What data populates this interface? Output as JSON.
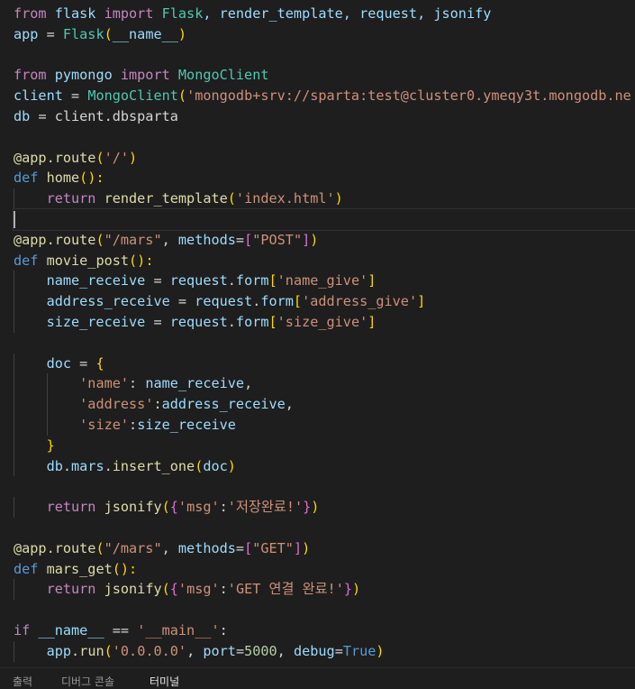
{
  "editor": {
    "language": "python",
    "current_line_index": 10,
    "lines": [
      {
        "tokens": [
          {
            "t": "from",
            "c": "k"
          },
          {
            "t": " flask ",
            "c": "v"
          },
          {
            "t": "import",
            "c": "k"
          },
          {
            "t": " ",
            "c": "p"
          },
          {
            "t": "Flask",
            "c": "cls"
          },
          {
            "t": ", render_template, request, jsonify",
            "c": "v"
          }
        ]
      },
      {
        "tokens": [
          {
            "t": "app",
            "c": "v"
          },
          {
            "t": " = ",
            "c": "p"
          },
          {
            "t": "Flask",
            "c": "cls"
          },
          {
            "t": "(",
            "c": "b1"
          },
          {
            "t": "__name__",
            "c": "v"
          },
          {
            "t": ")",
            "c": "b1"
          }
        ]
      },
      {
        "tokens": []
      },
      {
        "tokens": [
          {
            "t": "from",
            "c": "k"
          },
          {
            "t": " pymongo ",
            "c": "v"
          },
          {
            "t": "import",
            "c": "k"
          },
          {
            "t": " ",
            "c": "p"
          },
          {
            "t": "MongoClient",
            "c": "cls"
          }
        ]
      },
      {
        "tokens": [
          {
            "t": "client",
            "c": "v"
          },
          {
            "t": " = ",
            "c": "p"
          },
          {
            "t": "MongoClient",
            "c": "cls"
          },
          {
            "t": "(",
            "c": "b1"
          },
          {
            "t": "'mongodb+srv://sparta:test@cluster0.ymeqy3t.mongodb.ne",
            "c": "s"
          }
        ]
      },
      {
        "tokens": [
          {
            "t": "db",
            "c": "v"
          },
          {
            "t": " = client.dbsparta",
            "c": "p"
          }
        ]
      },
      {
        "tokens": []
      },
      {
        "tokens": [
          {
            "t": "@app.route",
            "c": "f"
          },
          {
            "t": "(",
            "c": "b1"
          },
          {
            "t": "'/'",
            "c": "s"
          },
          {
            "t": ")",
            "c": "b1"
          }
        ]
      },
      {
        "tokens": [
          {
            "t": "def",
            "c": "d"
          },
          {
            "t": " ",
            "c": "p"
          },
          {
            "t": "home",
            "c": "f"
          },
          {
            "t": "():",
            "c": "b1"
          }
        ]
      },
      {
        "tokens": [
          {
            "t": "    ",
            "c": "p"
          },
          {
            "t": "return",
            "c": "k"
          },
          {
            "t": " render_template",
            "c": "f"
          },
          {
            "t": "(",
            "c": "b1"
          },
          {
            "t": "'index.html'",
            "c": "s"
          },
          {
            "t": ")",
            "c": "b1"
          }
        ]
      },
      {
        "tokens": []
      },
      {
        "tokens": [
          {
            "t": "@app.route",
            "c": "f"
          },
          {
            "t": "(",
            "c": "b1"
          },
          {
            "t": "\"/mars\"",
            "c": "s"
          },
          {
            "t": ", ",
            "c": "p"
          },
          {
            "t": "methods",
            "c": "v"
          },
          {
            "t": "=",
            "c": "p"
          },
          {
            "t": "[",
            "c": "b2"
          },
          {
            "t": "\"POST\"",
            "c": "s"
          },
          {
            "t": "]",
            "c": "b2"
          },
          {
            "t": ")",
            "c": "b1"
          }
        ]
      },
      {
        "tokens": [
          {
            "t": "def",
            "c": "d"
          },
          {
            "t": " ",
            "c": "p"
          },
          {
            "t": "movie_post",
            "c": "f"
          },
          {
            "t": "():",
            "c": "b1"
          }
        ]
      },
      {
        "tokens": [
          {
            "t": "    name_receive",
            "c": "v"
          },
          {
            "t": " = ",
            "c": "p"
          },
          {
            "t": "request",
            "c": "v"
          },
          {
            "t": ".",
            "c": "p"
          },
          {
            "t": "form",
            "c": "v"
          },
          {
            "t": "[",
            "c": "b1"
          },
          {
            "t": "'name_give'",
            "c": "s"
          },
          {
            "t": "]",
            "c": "b1"
          }
        ]
      },
      {
        "tokens": [
          {
            "t": "    address_receive",
            "c": "v"
          },
          {
            "t": " = ",
            "c": "p"
          },
          {
            "t": "request",
            "c": "v"
          },
          {
            "t": ".",
            "c": "p"
          },
          {
            "t": "form",
            "c": "v"
          },
          {
            "t": "[",
            "c": "b1"
          },
          {
            "t": "'address_give'",
            "c": "s"
          },
          {
            "t": "]",
            "c": "b1"
          }
        ]
      },
      {
        "tokens": [
          {
            "t": "    size_receive",
            "c": "v"
          },
          {
            "t": " = ",
            "c": "p"
          },
          {
            "t": "request",
            "c": "v"
          },
          {
            "t": ".",
            "c": "p"
          },
          {
            "t": "form",
            "c": "v"
          },
          {
            "t": "[",
            "c": "b1"
          },
          {
            "t": "'size_give'",
            "c": "s"
          },
          {
            "t": "]",
            "c": "b1"
          }
        ]
      },
      {
        "tokens": []
      },
      {
        "tokens": [
          {
            "t": "    doc",
            "c": "v"
          },
          {
            "t": " = ",
            "c": "p"
          },
          {
            "t": "{",
            "c": "b1"
          }
        ]
      },
      {
        "tokens": [
          {
            "t": "        ",
            "c": "p"
          },
          {
            "t": "'name'",
            "c": "s"
          },
          {
            "t": ": ",
            "c": "p"
          },
          {
            "t": "name_receive",
            "c": "v"
          },
          {
            "t": ",",
            "c": "p"
          }
        ]
      },
      {
        "tokens": [
          {
            "t": "        ",
            "c": "p"
          },
          {
            "t": "'address'",
            "c": "s"
          },
          {
            "t": ":",
            "c": "p"
          },
          {
            "t": "address_receive",
            "c": "v"
          },
          {
            "t": ",",
            "c": "p"
          }
        ]
      },
      {
        "tokens": [
          {
            "t": "        ",
            "c": "p"
          },
          {
            "t": "'size'",
            "c": "s"
          },
          {
            "t": ":",
            "c": "p"
          },
          {
            "t": "size_receive",
            "c": "v"
          }
        ]
      },
      {
        "tokens": [
          {
            "t": "    ",
            "c": "p"
          },
          {
            "t": "}",
            "c": "b1"
          }
        ]
      },
      {
        "tokens": [
          {
            "t": "    db",
            "c": "v"
          },
          {
            "t": ".",
            "c": "p"
          },
          {
            "t": "mars",
            "c": "v"
          },
          {
            "t": ".",
            "c": "p"
          },
          {
            "t": "insert_one",
            "c": "f"
          },
          {
            "t": "(",
            "c": "b1"
          },
          {
            "t": "doc",
            "c": "v"
          },
          {
            "t": ")",
            "c": "b1"
          }
        ]
      },
      {
        "tokens": []
      },
      {
        "tokens": [
          {
            "t": "    ",
            "c": "p"
          },
          {
            "t": "return",
            "c": "k"
          },
          {
            "t": " jsonify",
            "c": "f"
          },
          {
            "t": "(",
            "c": "b1"
          },
          {
            "t": "{",
            "c": "b2"
          },
          {
            "t": "'msg'",
            "c": "s"
          },
          {
            "t": ":",
            "c": "p"
          },
          {
            "t": "'저장완료!'",
            "c": "s"
          },
          {
            "t": "}",
            "c": "b2"
          },
          {
            "t": ")",
            "c": "b1"
          }
        ]
      },
      {
        "tokens": []
      },
      {
        "tokens": [
          {
            "t": "@app.route",
            "c": "f"
          },
          {
            "t": "(",
            "c": "b1"
          },
          {
            "t": "\"/mars\"",
            "c": "s"
          },
          {
            "t": ", ",
            "c": "p"
          },
          {
            "t": "methods",
            "c": "v"
          },
          {
            "t": "=",
            "c": "p"
          },
          {
            "t": "[",
            "c": "b2"
          },
          {
            "t": "\"GET\"",
            "c": "s"
          },
          {
            "t": "]",
            "c": "b2"
          },
          {
            "t": ")",
            "c": "b1"
          }
        ]
      },
      {
        "tokens": [
          {
            "t": "def",
            "c": "d"
          },
          {
            "t": " ",
            "c": "p"
          },
          {
            "t": "mars_get",
            "c": "f"
          },
          {
            "t": "():",
            "c": "b1"
          }
        ]
      },
      {
        "tokens": [
          {
            "t": "    ",
            "c": "p"
          },
          {
            "t": "return",
            "c": "k"
          },
          {
            "t": " jsonify",
            "c": "f"
          },
          {
            "t": "(",
            "c": "b1"
          },
          {
            "t": "{",
            "c": "b2"
          },
          {
            "t": "'msg'",
            "c": "s"
          },
          {
            "t": ":",
            "c": "p"
          },
          {
            "t": "'GET 연결 완료!'",
            "c": "s"
          },
          {
            "t": "}",
            "c": "b2"
          },
          {
            "t": ")",
            "c": "b1"
          }
        ]
      },
      {
        "tokens": []
      },
      {
        "tokens": [
          {
            "t": "if",
            "c": "k"
          },
          {
            "t": " ",
            "c": "p"
          },
          {
            "t": "__name__",
            "c": "v"
          },
          {
            "t": " == ",
            "c": "p"
          },
          {
            "t": "'__main__'",
            "c": "s"
          },
          {
            "t": ":",
            "c": "p"
          }
        ]
      },
      {
        "tokens": [
          {
            "t": "    app",
            "c": "v"
          },
          {
            "t": ".",
            "c": "p"
          },
          {
            "t": "run",
            "c": "f"
          },
          {
            "t": "(",
            "c": "b1"
          },
          {
            "t": "'0.0.0.0'",
            "c": "s"
          },
          {
            "t": ", ",
            "c": "p"
          },
          {
            "t": "port",
            "c": "v"
          },
          {
            "t": "=",
            "c": "p"
          },
          {
            "t": "5000",
            "c": "n"
          },
          {
            "t": ", ",
            "c": "p"
          },
          {
            "t": "debug",
            "c": "v"
          },
          {
            "t": "=",
            "c": "p"
          },
          {
            "t": "True",
            "c": "d"
          },
          {
            "t": ")",
            "c": "b1"
          }
        ]
      }
    ]
  },
  "panel": {
    "tabs": [
      {
        "label": "출력",
        "active": false
      },
      {
        "label": "디버그 콘솔",
        "active": false
      },
      {
        "label": "터미널",
        "active": true
      }
    ]
  },
  "colors": {
    "k": "#c586c0",
    "d": "#569cd6",
    "v": "#9cdcfe",
    "cls": "#4ec9b0",
    "f": "#dcdcaa",
    "s": "#ce9178",
    "n": "#b5cea8",
    "b1": "#ffd700",
    "b2": "#da70d6",
    "p": "#d4d4d4"
  }
}
